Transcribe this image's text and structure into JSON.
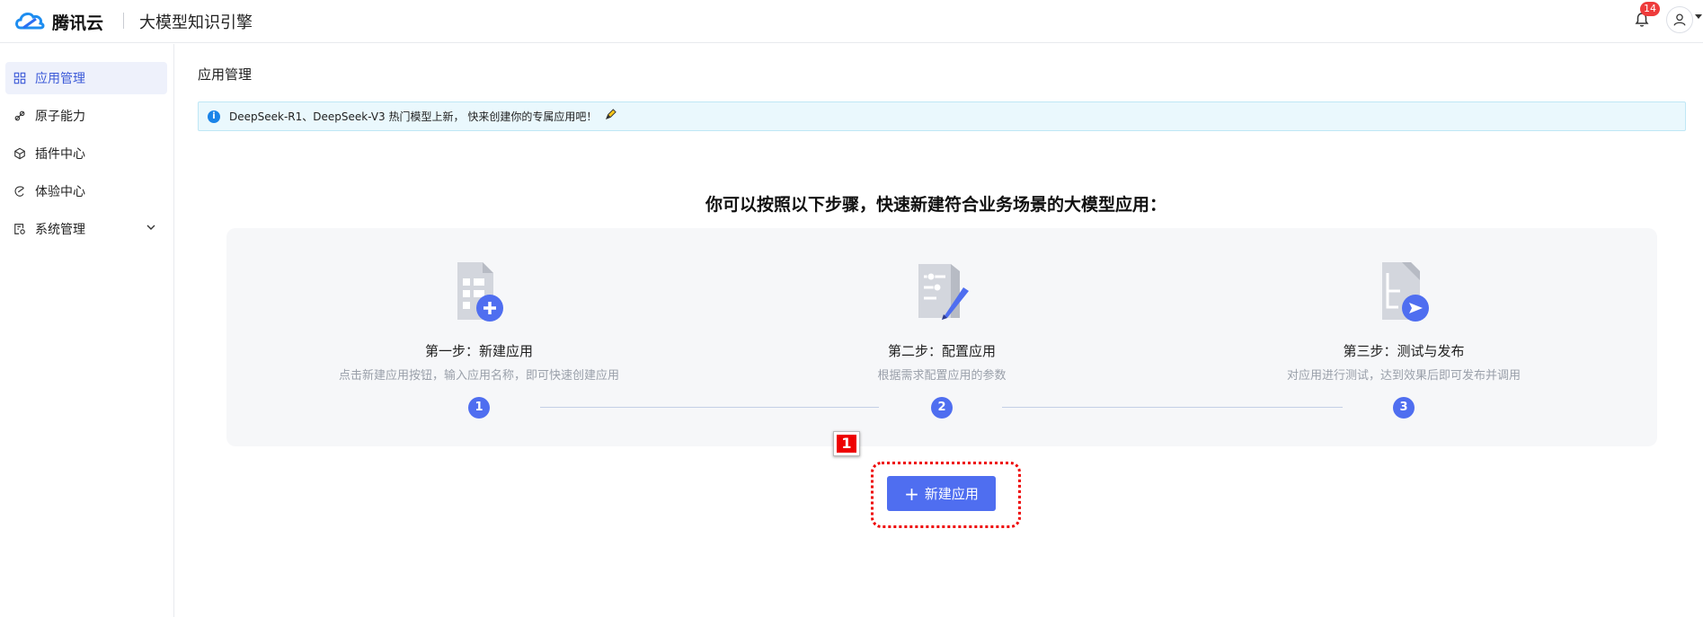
{
  "header": {
    "logo_text": "腾讯云",
    "product_name": "大模型知识引擎",
    "notification_count": "14"
  },
  "sidebar": {
    "items": [
      {
        "label": "应用管理",
        "icon": "grid-icon"
      },
      {
        "label": "原子能力",
        "icon": "atom-icon"
      },
      {
        "label": "插件中心",
        "icon": "cube-icon"
      },
      {
        "label": "体验中心",
        "icon": "experience-icon"
      },
      {
        "label": "系统管理",
        "icon": "settings-doc-icon"
      }
    ]
  },
  "main": {
    "page_title": "应用管理",
    "notice": "DeepSeek-R1、DeepSeek-V3 热门模型上新， 快来创建你的专属应用吧！",
    "guide_heading": "你可以按照以下步骤，快速新建符合业务场景的大模型应用：",
    "steps": [
      {
        "number": "1",
        "title": "第一步：新建应用",
        "desc": "点击新建应用按钮，输入应用名称，即可快速创建应用"
      },
      {
        "number": "2",
        "title": "第二步：配置应用",
        "desc": "根据需求配置应用的参数"
      },
      {
        "number": "3",
        "title": "第三步：测试与发布",
        "desc": "对应用进行测试，达到效果后即可发布并调用"
      }
    ],
    "create_button": "新建应用",
    "annotation_label": "1"
  },
  "colors": {
    "accent": "#4f6ef0",
    "active_bg": "#eef1fb",
    "notice_bg": "#eaf8fd",
    "annotation": "#ee0000"
  }
}
